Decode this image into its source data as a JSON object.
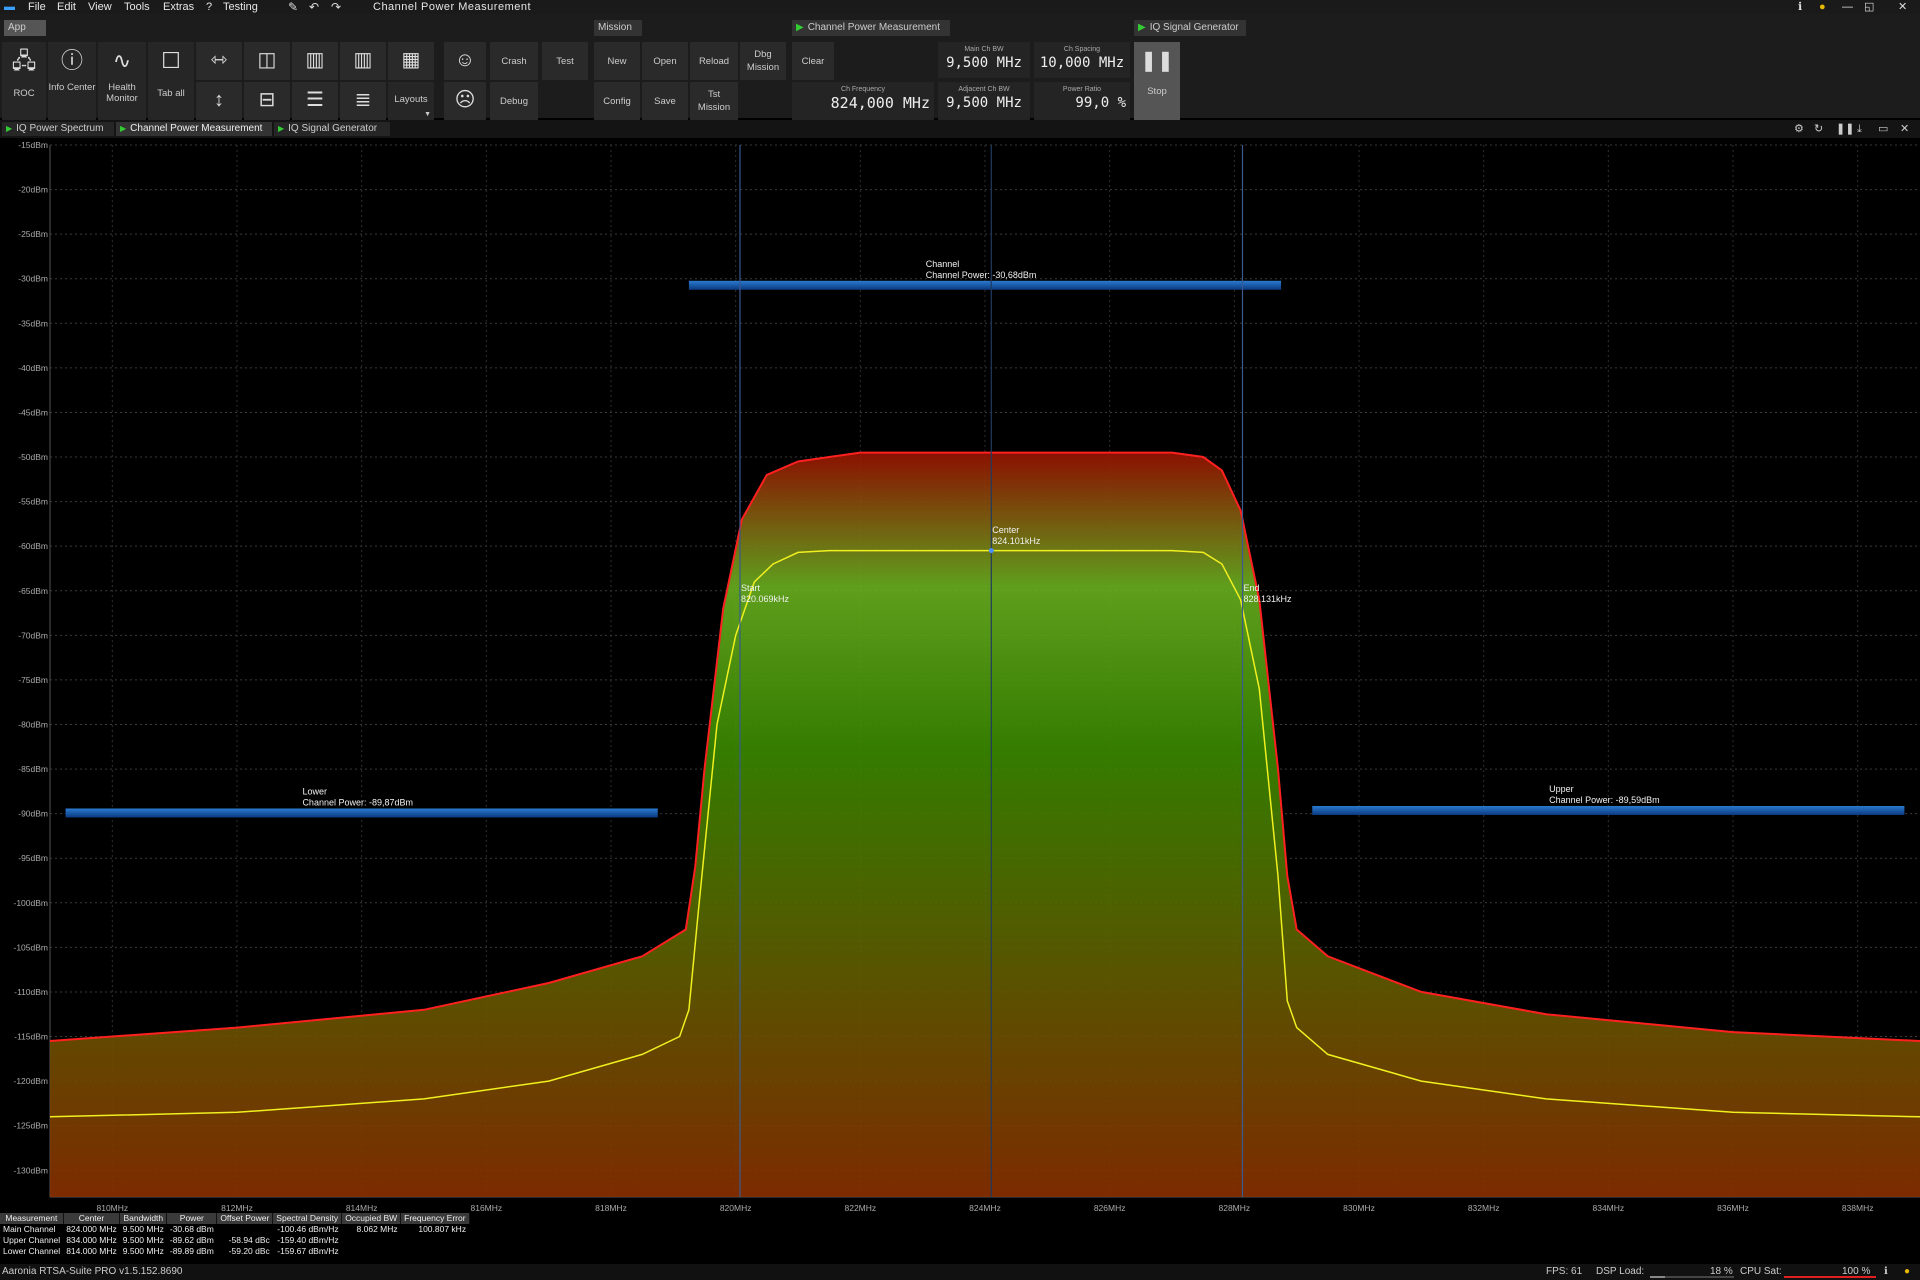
{
  "menubar": {
    "items": [
      "File",
      "Edit",
      "View",
      "Tools",
      "Extras",
      "?",
      "Testing"
    ],
    "window_title": "Channel Power Measurement"
  },
  "ribbon": {
    "groups": {
      "app": "App",
      "mission": "Mission",
      "channel_power": "Channel Power Measurement",
      "iq_generator": "IQ Signal Generator"
    },
    "app_buttons": {
      "roc": "ROC",
      "info_center": "Info Center",
      "health_monitor": "Health Monitor",
      "tab_all": "Tab all",
      "layouts": "Layouts",
      "crash": "Crash",
      "test": "Test",
      "debug": "Debug"
    },
    "mission_buttons": {
      "new": "New",
      "open": "Open",
      "reload": "Reload",
      "dbg_mission": "Dbg Mission",
      "clear": "Clear",
      "config": "Config",
      "save": "Save",
      "tst_mission": "Tst Mission"
    },
    "values": {
      "main_ch_bw_label": "Main Ch BW",
      "main_ch_bw": "9,500 MHz",
      "ch_spacing_label": "Ch Spacing",
      "ch_spacing": "10,000 MHz",
      "ch_frequency_label": "Ch Frequency",
      "ch_frequency": "824,000 MHz",
      "adjacent_ch_bw_label": "Adjacent Ch BW",
      "adjacent_ch_bw": "9,500 MHz",
      "power_ratio_label": "Power Ratio",
      "power_ratio": "99,0 %"
    },
    "stop_label": "Stop"
  },
  "tabs": [
    {
      "label": "IQ Power Spectrum",
      "active": false
    },
    {
      "label": "Channel Power Measurement",
      "active": true
    },
    {
      "label": "IQ Signal Generator",
      "active": false
    }
  ],
  "chart_data": {
    "type": "line",
    "y_axis_unit": "dBm",
    "ylim": [
      -133,
      -15
    ],
    "y_ticks": [
      "-15dBm",
      "-20dBm",
      "-25dBm",
      "-30dBm",
      "-35dBm",
      "-40dBm",
      "-45dBm",
      "-50dBm",
      "-55dBm",
      "-60dBm",
      "-65dBm",
      "-70dBm",
      "-75dBm",
      "-80dBm",
      "-85dBm",
      "-90dBm",
      "-95dBm",
      "-100dBm",
      "-105dBm",
      "-110dBm",
      "-115dBm",
      "-120dBm",
      "-125dBm",
      "-130dBm"
    ],
    "xlim_mhz": [
      809,
      839
    ],
    "x_ticks": [
      "810MHz",
      "812MHz",
      "814MHz",
      "816MHz",
      "818MHz",
      "820MHz",
      "822MHz",
      "824MHz",
      "826MHz",
      "828MHz",
      "830MHz",
      "832MHz",
      "834MHz",
      "836MHz",
      "838MHz"
    ],
    "grid": true,
    "series": [
      {
        "color": "#ff2020",
        "x": [
          809,
          812,
          815,
          817,
          818.5,
          819.2,
          819.35,
          819.5,
          819.8,
          820.1,
          820.5,
          821,
          821.5,
          822,
          823,
          824,
          825,
          826,
          827,
          827.5,
          827.8,
          828.1,
          828.4,
          828.7,
          828.85,
          829.0,
          829.5,
          831,
          833,
          836,
          839
        ],
        "y": [
          -115.5,
          -114,
          -112,
          -109,
          -106,
          -103,
          -96,
          -85,
          -67,
          -57,
          -52,
          -50.5,
          -50,
          -49.5,
          -49.5,
          -49.5,
          -49.5,
          -49.5,
          -49.5,
          -50,
          -51.5,
          -56,
          -66,
          -85,
          -97,
          -103,
          -106,
          -110,
          -112.5,
          -114.5,
          -115.5
        ]
      },
      {
        "color": "#f0f020",
        "x": [
          809,
          812,
          815,
          817,
          818.5,
          819.1,
          819.25,
          819.4,
          819.7,
          820,
          820.3,
          820.6,
          821,
          821.5,
          822,
          823,
          824,
          825,
          826,
          827,
          827.5,
          827.8,
          828.1,
          828.4,
          828.7,
          828.85,
          829.0,
          829.5,
          831,
          833,
          836,
          839
        ],
        "y": [
          -124,
          -123.5,
          -122,
          -120,
          -117,
          -115,
          -112,
          -101,
          -80,
          -70,
          -64,
          -62,
          -60.7,
          -60.5,
          -60.5,
          -60.5,
          -60.5,
          -60.5,
          -60.5,
          -60.5,
          -60.7,
          -62,
          -66,
          -76,
          -97,
          -111,
          -114,
          -117,
          -120,
          -122,
          -123.5,
          -124
        ]
      }
    ],
    "channels": [
      {
        "name": "Lower",
        "center_mhz": 814,
        "bw_mhz": 9.5,
        "power_dbm": -89.87,
        "label_title": "Lower",
        "label_power": "Channel Power: -89,87dBm"
      },
      {
        "name": "Channel",
        "center_mhz": 824,
        "bw_mhz": 9.5,
        "power_dbm": -30.68,
        "label_title": "Channel",
        "label_power": "Channel Power: -30,68dBm"
      },
      {
        "name": "Upper",
        "center_mhz": 834,
        "bw_mhz": 9.5,
        "power_dbm": -89.59,
        "label_title": "Upper",
        "label_power": "Channel Power: -89,59dBm"
      }
    ],
    "markers": [
      {
        "name": "Start",
        "x_mhz": 820.069,
        "label": "Start",
        "value": "820.069kHz"
      },
      {
        "name": "Center",
        "x_mhz": 824.101,
        "label": "Center",
        "value": "824.101kHz"
      },
      {
        "name": "End",
        "x_mhz": 828.131,
        "label": "End",
        "value": "828.131kHz"
      }
    ]
  },
  "table": {
    "headers": [
      "Measurement",
      "Center",
      "Bandwidth",
      "Power",
      "Offset Power",
      "Spectral Density",
      "Occupied BW",
      "Frequency Error"
    ],
    "rows": [
      [
        "Main Channel",
        "824.000 MHz",
        "9.500 MHz",
        "-30.68 dBm",
        "",
        "-100.46 dBm/Hz",
        "8.062 MHz",
        "100.807 kHz"
      ],
      [
        "Upper Channel",
        "834.000 MHz",
        "9.500 MHz",
        "-89.62 dBm",
        "-58.94 dBc",
        "-159.40 dBm/Hz",
        "",
        ""
      ],
      [
        "Lower Channel",
        "814.000 MHz",
        "9.500 MHz",
        "-89.89 dBm",
        "-59.20 dBc",
        "-159.67 dBm/Hz",
        "",
        ""
      ]
    ]
  },
  "status": {
    "app_version": "Aaronia RTSA-Suite PRO v1.5.152.8690",
    "fps_label": "FPS: 61",
    "dsp_label": "DSP Load:",
    "dsp_value": "18 %",
    "dsp_fraction": 0.18,
    "cpu_label": "CPU Sat:",
    "cpu_value": "100 %",
    "cpu_fraction": 1.0
  }
}
